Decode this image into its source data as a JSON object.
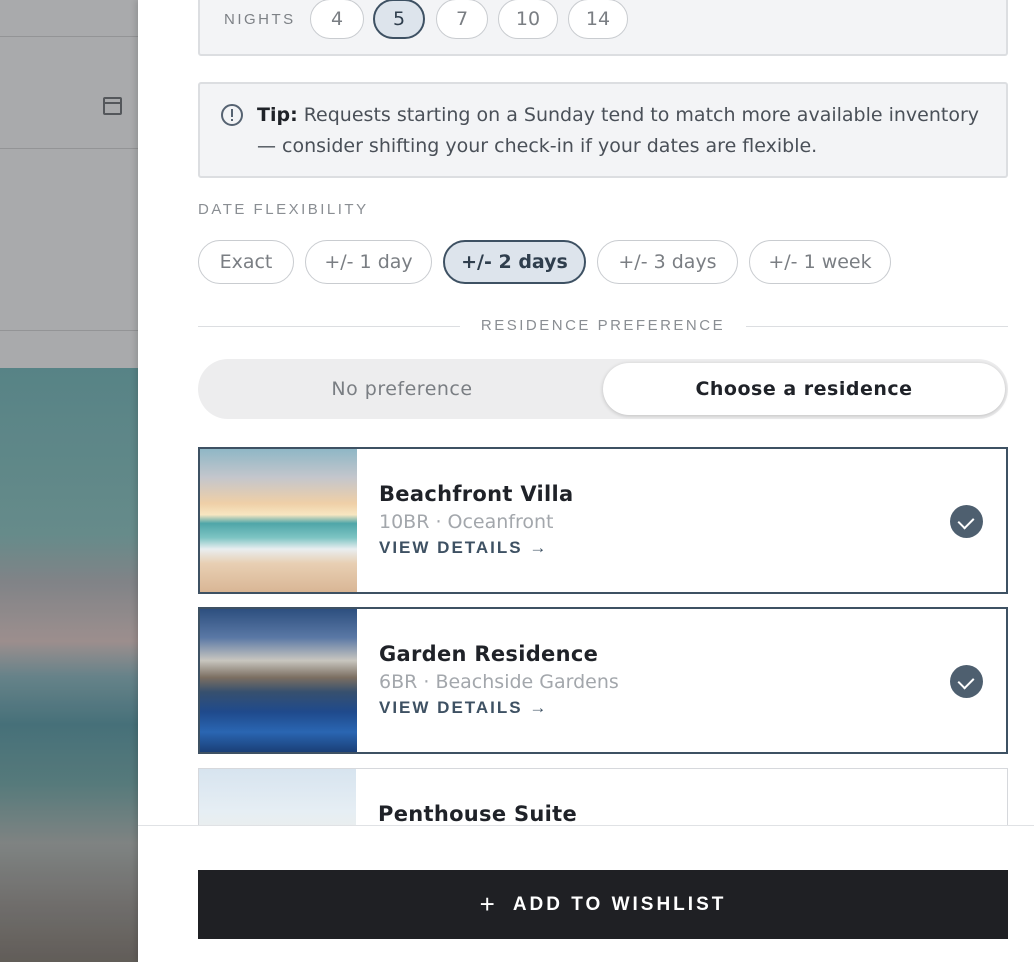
{
  "nights": {
    "label": "NIGHTS",
    "options": [
      "4",
      "5",
      "7",
      "10",
      "14"
    ],
    "selected": "5"
  },
  "tip": {
    "bold": "Tip:",
    "text": " Requests starting on a Sunday tend to match more available inventory — consider shifting your check-in if your dates are flexible."
  },
  "date_flexibility": {
    "label": "DATE FLEXIBILITY",
    "options": [
      "Exact",
      "+/- 1 day",
      "+/- 2 days",
      "+/- 3 days",
      "+/- 1 week"
    ],
    "selected": "+/- 2 days"
  },
  "residence_preference": {
    "label": "RESIDENCE PREFERENCE",
    "options": [
      "No preference",
      "Choose a residence"
    ],
    "selected": "Choose a residence"
  },
  "residences": [
    {
      "title": "Beachfront Villa",
      "sub": "10BR · Oceanfront",
      "link": "VIEW DETAILS →",
      "selected": true
    },
    {
      "title": "Garden Residence",
      "sub": "6BR · Beachside Gardens",
      "link": "VIEW DETAILS →",
      "selected": true
    },
    {
      "title": "Penthouse Suite",
      "sub": "",
      "link": "",
      "selected": false
    }
  ],
  "cta": {
    "icon": "+",
    "label": "ADD TO WISHLIST"
  },
  "colors": {
    "accent": "#3e5163",
    "cta_bg": "#1f2024",
    "check": "#4e5f6f"
  }
}
